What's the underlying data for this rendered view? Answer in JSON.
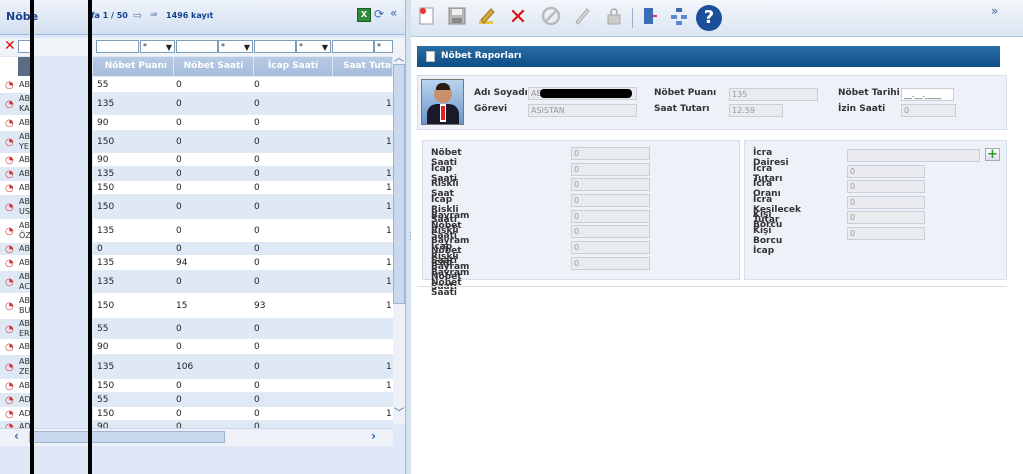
{
  "left": {
    "title": "Nöbe",
    "paging": "fa 1 / 50",
    "record_count": "1496 kayıt",
    "filters": [
      "*",
      "*",
      "*",
      "*"
    ],
    "columns": [
      "Nöbet Puanı",
      "Nöbet Saati",
      "İcap Saati",
      "Saat Tutarı"
    ],
    "rows": [
      {
        "name": "AB",
        "name2": "",
        "puan": "55",
        "saat": "0",
        "icap": "0",
        "tutar": ""
      },
      {
        "name": "AB",
        "name2": "KA",
        "puan": "135",
        "saat": "0",
        "icap": "0",
        "tutar": "1"
      },
      {
        "name": "AB",
        "name2": "",
        "puan": "90",
        "saat": "0",
        "icap": "0",
        "tutar": ""
      },
      {
        "name": "AB",
        "name2": "YE",
        "puan": "150",
        "saat": "0",
        "icap": "0",
        "tutar": "1"
      },
      {
        "name": "AB",
        "name2": "",
        "puan": "90",
        "saat": "0",
        "icap": "0",
        "tutar": ""
      },
      {
        "name": "AB",
        "name2": "",
        "puan": "135",
        "saat": "0",
        "icap": "0",
        "tutar": "1"
      },
      {
        "name": "AB",
        "name2": "",
        "puan": "150",
        "saat": "0",
        "icap": "0",
        "tutar": "1"
      },
      {
        "name": "AB",
        "name2": "US",
        "puan": "150",
        "saat": "0",
        "icap": "0",
        "tutar": "1"
      },
      {
        "name": "AB",
        "name2": "ÖZ",
        "puan": "135",
        "saat": "0",
        "icap": "0",
        "tutar": "1"
      },
      {
        "name": "AB",
        "name2": "",
        "puan": "0",
        "saat": "0",
        "icap": "0",
        "tutar": ""
      },
      {
        "name": "AB",
        "name2": "",
        "puan": "135",
        "saat": "94",
        "icap": "0",
        "tutar": "1"
      },
      {
        "name": "AB",
        "name2": "AC",
        "puan": "135",
        "saat": "0",
        "icap": "0",
        "tutar": "1"
      },
      {
        "name": "AB",
        "name2": "BU",
        "puan": "150",
        "saat": "15",
        "icap": "93",
        "tutar": "1"
      },
      {
        "name": "AB",
        "name2": "ER",
        "puan": "55",
        "saat": "0",
        "icap": "0",
        "tutar": ""
      },
      {
        "name": "AB",
        "name2": "",
        "puan": "90",
        "saat": "0",
        "icap": "0",
        "tutar": ""
      },
      {
        "name": "AB",
        "name2": "ZE",
        "puan": "135",
        "saat": "106",
        "icap": "0",
        "tutar": "1"
      },
      {
        "name": "AB",
        "name2": "",
        "puan": "150",
        "saat": "0",
        "icap": "0",
        "tutar": "1"
      },
      {
        "name": "AD",
        "name2": "",
        "puan": "55",
        "saat": "0",
        "icap": "0",
        "tutar": ""
      },
      {
        "name": "AD",
        "name2": "",
        "puan": "150",
        "saat": "0",
        "icap": "0",
        "tutar": "1"
      },
      {
        "name": "AD",
        "name2": "",
        "puan": "90",
        "saat": "0",
        "icap": "0",
        "tutar": ""
      }
    ]
  },
  "toolbar": {
    "icons": [
      "new-icon",
      "save-icon",
      "edit-icon",
      "delete-icon",
      "cancel-icon",
      "edit-pen-icon",
      "lock-icon",
      "exit-icon",
      "tree-icon",
      "help-icon"
    ]
  },
  "detail": {
    "title": "Nöbet Raporları",
    "adi_soyadi_label": "Adı Soyadı",
    "adi_soyadi_value": "AB",
    "gorevi_label": "Görevi",
    "gorevi_value": "ASISTAN",
    "nobet_puani_label": "Nöbet Puanı",
    "nobet_puani_value": "135",
    "saat_tutari_label": "Saat Tutarı",
    "saat_tutari_value": "12.59",
    "nobet_tarihi_label": "Nöbet Tarihi",
    "nobet_tarihi_value": "__.__.____",
    "izin_saati_label": "İzin Saati",
    "izin_saati_value": "0",
    "left_fields": [
      {
        "label": "Nöbet Saati",
        "value": "0"
      },
      {
        "label": "İcap Saati",
        "value": "0"
      },
      {
        "label": "Riskli Saat",
        "value": "0"
      },
      {
        "label": "İcap Riskli Saati",
        "value": "0"
      },
      {
        "label": "Bayram Nöbet Saati",
        "value": "0"
      },
      {
        "label": "Riskli Bayram Nöbet Saati",
        "value": "0"
      },
      {
        "label": "İcap Riskli Bayram Nöbet Saati",
        "value": "0"
      },
      {
        "label": "İcap Bayram Nöbet Saati",
        "value": "0"
      }
    ],
    "right_fields": [
      {
        "label": "İcra Dairesi",
        "value": ""
      },
      {
        "label": "İcra Tutarı",
        "value": "0"
      },
      {
        "label": "İcra Oranı",
        "value": "0"
      },
      {
        "label": "İcra Kesilecek Tutar",
        "value": "0"
      },
      {
        "label": "Kişi Borcu",
        "value": "0"
      },
      {
        "label": "Kişi Borcu İcap",
        "value": "0"
      }
    ]
  }
}
